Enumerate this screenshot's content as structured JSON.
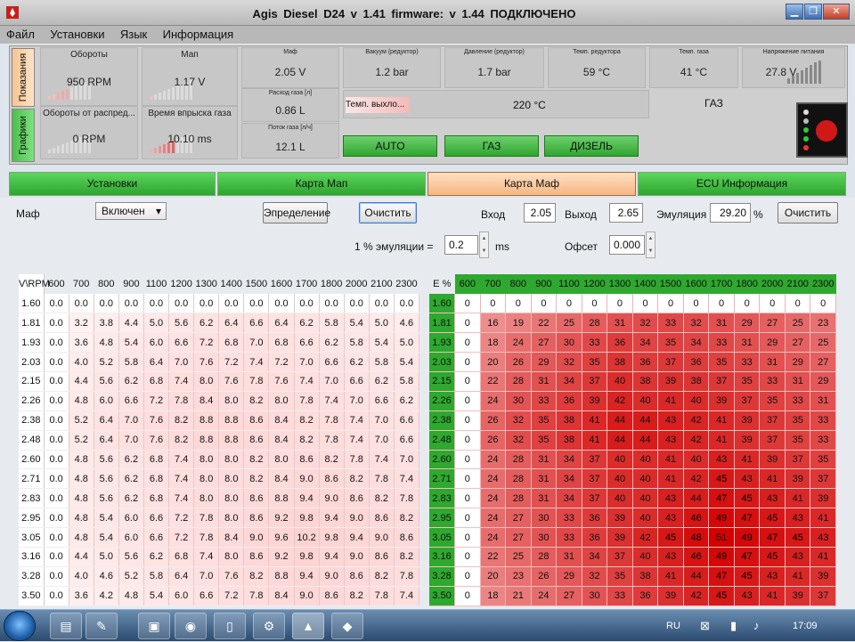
{
  "window": {
    "title": "Agis Diesel  D24  v 1.41   firmware: v 1.44    ПОДКЛЮЧЕНО"
  },
  "menu": [
    "Файл",
    "Установки",
    "Язык",
    "Информация"
  ],
  "side_tabs": {
    "readings": "Показания",
    "graphs": "Графики"
  },
  "gauges": {
    "rpm": {
      "label": "Обороты",
      "value": "950 RPM"
    },
    "map": {
      "label": "Мап",
      "value": "1.17 V"
    },
    "maf": {
      "label": "Маф",
      "value": "2.05 V"
    },
    "vacuum": {
      "label": "Вакуум (редуктор)",
      "value": "1.2 bar"
    },
    "pressure": {
      "label": "Давление (редуктор)",
      "value": "1.7 bar"
    },
    "reducer_temp": {
      "label": "Темп. редуктора",
      "value": "59 °C"
    },
    "gas_temp": {
      "label": "Темп. газа",
      "value": "41 °C"
    },
    "voltage": {
      "label": "Напряжение питания",
      "value": "27.8 V"
    },
    "pump_rpm": {
      "label": "Обороты от распред...",
      "value": "0 RPM"
    },
    "injection_time": {
      "label": "Время впрыска  газа",
      "value": "10.10 ms"
    },
    "gas_flow": {
      "label": "Расход газа [л]",
      "value": "0.86 L"
    },
    "gas_stream": {
      "label": "Поток газа [л/ч]",
      "value": "12.1 L"
    },
    "exhaust_temp": {
      "label": "Темп. выхло...",
      "value": "220 °C"
    },
    "fuel_mode": "ГАЗ"
  },
  "mode_buttons": [
    "AUTO",
    "ГАЗ",
    "ДИЗЕЛЬ"
  ],
  "nav_tabs": [
    "Установки",
    "Карта Мап",
    "Карта Маф",
    "ECU Информация"
  ],
  "controls": {
    "maf_label": "Маф",
    "maf_select": "Включен",
    "define_button": "Эпределение",
    "clear_button": "Очистить",
    "input_label": "Вход",
    "input_value": "2.05",
    "output_label": "Выход",
    "output_value": "2.65",
    "emulation_label": "Эмуляция",
    "emulation_value": "29.20",
    "percent": "%",
    "clear2_button": "Очистить",
    "emu_per_label": "1 % эмуляции =",
    "emu_per_value": "0.2",
    "ms": "ms",
    "offset_label": "Офсет",
    "offset_value": "0.000"
  },
  "maf_table": {
    "corner": "V\\RPM",
    "cols": [
      "600",
      "700",
      "800",
      "900",
      "1100",
      "1200",
      "1300",
      "1400",
      "1500",
      "1600",
      "1700",
      "1800",
      "2000",
      "2100",
      "2300"
    ],
    "rows": [
      {
        "v": "1.60",
        "vals": [
          "0.0",
          "0.0",
          "0.0",
          "0.0",
          "0.0",
          "0.0",
          "0.0",
          "0.0",
          "0.0",
          "0.0",
          "0.0",
          "0.0",
          "0.0",
          "0.0",
          "0.0"
        ]
      },
      {
        "v": "1.81",
        "vals": [
          "0.0",
          "3.2",
          "3.8",
          "4.4",
          "5.0",
          "5.6",
          "6.2",
          "6.4",
          "6.6",
          "6.4",
          "6.2",
          "5.8",
          "5.4",
          "5.0",
          "4.6"
        ]
      },
      {
        "v": "1.93",
        "vals": [
          "0.0",
          "3.6",
          "4.8",
          "5.4",
          "6.0",
          "6.6",
          "7.2",
          "6.8",
          "7.0",
          "6.8",
          "6.6",
          "6.2",
          "5.8",
          "5.4",
          "5.0"
        ]
      },
      {
        "v": "2.03",
        "vals": [
          "0.0",
          "4.0",
          "5.2",
          "5.8",
          "6.4",
          "7.0",
          "7.6",
          "7.2",
          "7.4",
          "7.2",
          "7.0",
          "6.6",
          "6.2",
          "5.8",
          "5.4"
        ]
      },
      {
        "v": "2.15",
        "vals": [
          "0.0",
          "4.4",
          "5.6",
          "6.2",
          "6.8",
          "7.4",
          "8.0",
          "7.6",
          "7.8",
          "7.6",
          "7.4",
          "7.0",
          "6.6",
          "6.2",
          "5.8"
        ]
      },
      {
        "v": "2.26",
        "vals": [
          "0.0",
          "4.8",
          "6.0",
          "6.6",
          "7.2",
          "7.8",
          "8.4",
          "8.0",
          "8.2",
          "8.0",
          "7.8",
          "7.4",
          "7.0",
          "6.6",
          "6.2"
        ]
      },
      {
        "v": "2.38",
        "vals": [
          "0.0",
          "5.2",
          "6.4",
          "7.0",
          "7.6",
          "8.2",
          "8.8",
          "8.8",
          "8.6",
          "8.4",
          "8.2",
          "7.8",
          "7.4",
          "7.0",
          "6.6"
        ]
      },
      {
        "v": "2.48",
        "vals": [
          "0.0",
          "5.2",
          "6.4",
          "7.0",
          "7.6",
          "8.2",
          "8.8",
          "8.8",
          "8.6",
          "8.4",
          "8.2",
          "7.8",
          "7.4",
          "7.0",
          "6.6"
        ]
      },
      {
        "v": "2.60",
        "vals": [
          "0.0",
          "4.8",
          "5.6",
          "6.2",
          "6.8",
          "7.4",
          "8.0",
          "8.0",
          "8.2",
          "8.0",
          "8.6",
          "8.2",
          "7.8",
          "7.4",
          "7.0"
        ]
      },
      {
        "v": "2.71",
        "vals": [
          "0.0",
          "4.8",
          "5.6",
          "6.2",
          "6.8",
          "7.4",
          "8.0",
          "8.0",
          "8.2",
          "8.4",
          "9.0",
          "8.6",
          "8.2",
          "7.8",
          "7.4"
        ]
      },
      {
        "v": "2.83",
        "vals": [
          "0.0",
          "4.8",
          "5.6",
          "6.2",
          "6.8",
          "7.4",
          "8.0",
          "8.0",
          "8.6",
          "8.8",
          "9.4",
          "9.0",
          "8.6",
          "8.2",
          "7.8"
        ]
      },
      {
        "v": "2.95",
        "vals": [
          "0.0",
          "4.8",
          "5.4",
          "6.0",
          "6.6",
          "7.2",
          "7.8",
          "8.0",
          "8.6",
          "9.2",
          "9.8",
          "9.4",
          "9.0",
          "8.6",
          "8.2"
        ]
      },
      {
        "v": "3.05",
        "vals": [
          "0.0",
          "4.8",
          "5.4",
          "6.0",
          "6.6",
          "7.2",
          "7.8",
          "8.4",
          "9.0",
          "9.6",
          "10.2",
          "9.8",
          "9.4",
          "9.0",
          "8.6"
        ]
      },
      {
        "v": "3.16",
        "vals": [
          "0.0",
          "4.4",
          "5.0",
          "5.6",
          "6.2",
          "6.8",
          "7.4",
          "8.0",
          "8.6",
          "9.2",
          "9.8",
          "9.4",
          "9.0",
          "8.6",
          "8.2"
        ]
      },
      {
        "v": "3.28",
        "vals": [
          "0.0",
          "4.0",
          "4.6",
          "5.2",
          "5.8",
          "6.4",
          "7.0",
          "7.6",
          "8.2",
          "8.8",
          "9.4",
          "9.0",
          "8.6",
          "8.2",
          "7.8"
        ]
      },
      {
        "v": "3.50",
        "vals": [
          "0.0",
          "3.6",
          "4.2",
          "4.8",
          "5.4",
          "6.0",
          "6.6",
          "7.2",
          "7.8",
          "8.4",
          "9.0",
          "8.6",
          "8.2",
          "7.8",
          "7.4"
        ]
      }
    ]
  },
  "emu_table": {
    "corner": "E %",
    "cols": [
      "600",
      "700",
      "800",
      "900",
      "1100",
      "1200",
      "1300",
      "1400",
      "1500",
      "1600",
      "1700",
      "1800",
      "2000",
      "2100",
      "2300"
    ],
    "rows": [
      {
        "v": "1.60",
        "vals": [
          "0",
          "0",
          "0",
          "0",
          "0",
          "0",
          "0",
          "0",
          "0",
          "0",
          "0",
          "0",
          "0",
          "0",
          "0"
        ]
      },
      {
        "v": "1.81",
        "vals": [
          "0",
          "16",
          "19",
          "22",
          "25",
          "28",
          "31",
          "32",
          "33",
          "32",
          "31",
          "29",
          "27",
          "25",
          "23"
        ]
      },
      {
        "v": "1.93",
        "vals": [
          "0",
          "18",
          "24",
          "27",
          "30",
          "33",
          "36",
          "34",
          "35",
          "34",
          "33",
          "31",
          "29",
          "27",
          "25"
        ]
      },
      {
        "v": "2.03",
        "vals": [
          "0",
          "20",
          "26",
          "29",
          "32",
          "35",
          "38",
          "36",
          "37",
          "36",
          "35",
          "33",
          "31",
          "29",
          "27"
        ]
      },
      {
        "v": "2.15",
        "vals": [
          "0",
          "22",
          "28",
          "31",
          "34",
          "37",
          "40",
          "38",
          "39",
          "38",
          "37",
          "35",
          "33",
          "31",
          "29"
        ]
      },
      {
        "v": "2.26",
        "vals": [
          "0",
          "24",
          "30",
          "33",
          "36",
          "39",
          "42",
          "40",
          "41",
          "40",
          "39",
          "37",
          "35",
          "33",
          "31"
        ]
      },
      {
        "v": "2.38",
        "vals": [
          "0",
          "26",
          "32",
          "35",
          "38",
          "41",
          "44",
          "44",
          "43",
          "42",
          "41",
          "39",
          "37",
          "35",
          "33"
        ]
      },
      {
        "v": "2.48",
        "vals": [
          "0",
          "26",
          "32",
          "35",
          "38",
          "41",
          "44",
          "44",
          "43",
          "42",
          "41",
          "39",
          "37",
          "35",
          "33"
        ]
      },
      {
        "v": "2.60",
        "vals": [
          "0",
          "24",
          "28",
          "31",
          "34",
          "37",
          "40",
          "40",
          "41",
          "40",
          "43",
          "41",
          "39",
          "37",
          "35"
        ]
      },
      {
        "v": "2.71",
        "vals": [
          "0",
          "24",
          "28",
          "31",
          "34",
          "37",
          "40",
          "40",
          "41",
          "42",
          "45",
          "43",
          "41",
          "39",
          "37"
        ]
      },
      {
        "v": "2.83",
        "vals": [
          "0",
          "24",
          "28",
          "31",
          "34",
          "37",
          "40",
          "40",
          "43",
          "44",
          "47",
          "45",
          "43",
          "41",
          "39"
        ]
      },
      {
        "v": "2.95",
        "vals": [
          "0",
          "24",
          "27",
          "30",
          "33",
          "36",
          "39",
          "40",
          "43",
          "46",
          "49",
          "47",
          "45",
          "43",
          "41"
        ]
      },
      {
        "v": "3.05",
        "vals": [
          "0",
          "24",
          "27",
          "30",
          "33",
          "36",
          "39",
          "42",
          "45",
          "48",
          "51",
          "49",
          "47",
          "45",
          "43"
        ]
      },
      {
        "v": "3.16",
        "vals": [
          "0",
          "22",
          "25",
          "28",
          "31",
          "34",
          "37",
          "40",
          "43",
          "46",
          "49",
          "47",
          "45",
          "43",
          "41"
        ]
      },
      {
        "v": "3.28",
        "vals": [
          "0",
          "20",
          "23",
          "26",
          "29",
          "32",
          "35",
          "38",
          "41",
          "44",
          "47",
          "45",
          "43",
          "41",
          "39"
        ]
      },
      {
        "v": "3.50",
        "vals": [
          "0",
          "18",
          "21",
          "24",
          "27",
          "30",
          "33",
          "36",
          "39",
          "42",
          "45",
          "43",
          "41",
          "39",
          "37"
        ]
      }
    ]
  },
  "taskbar": {
    "lang": "RU",
    "time": "17:09"
  },
  "colors": {
    "green": "#2ea82e",
    "active_tab": "#f6b680",
    "max_red": "#d40000"
  }
}
